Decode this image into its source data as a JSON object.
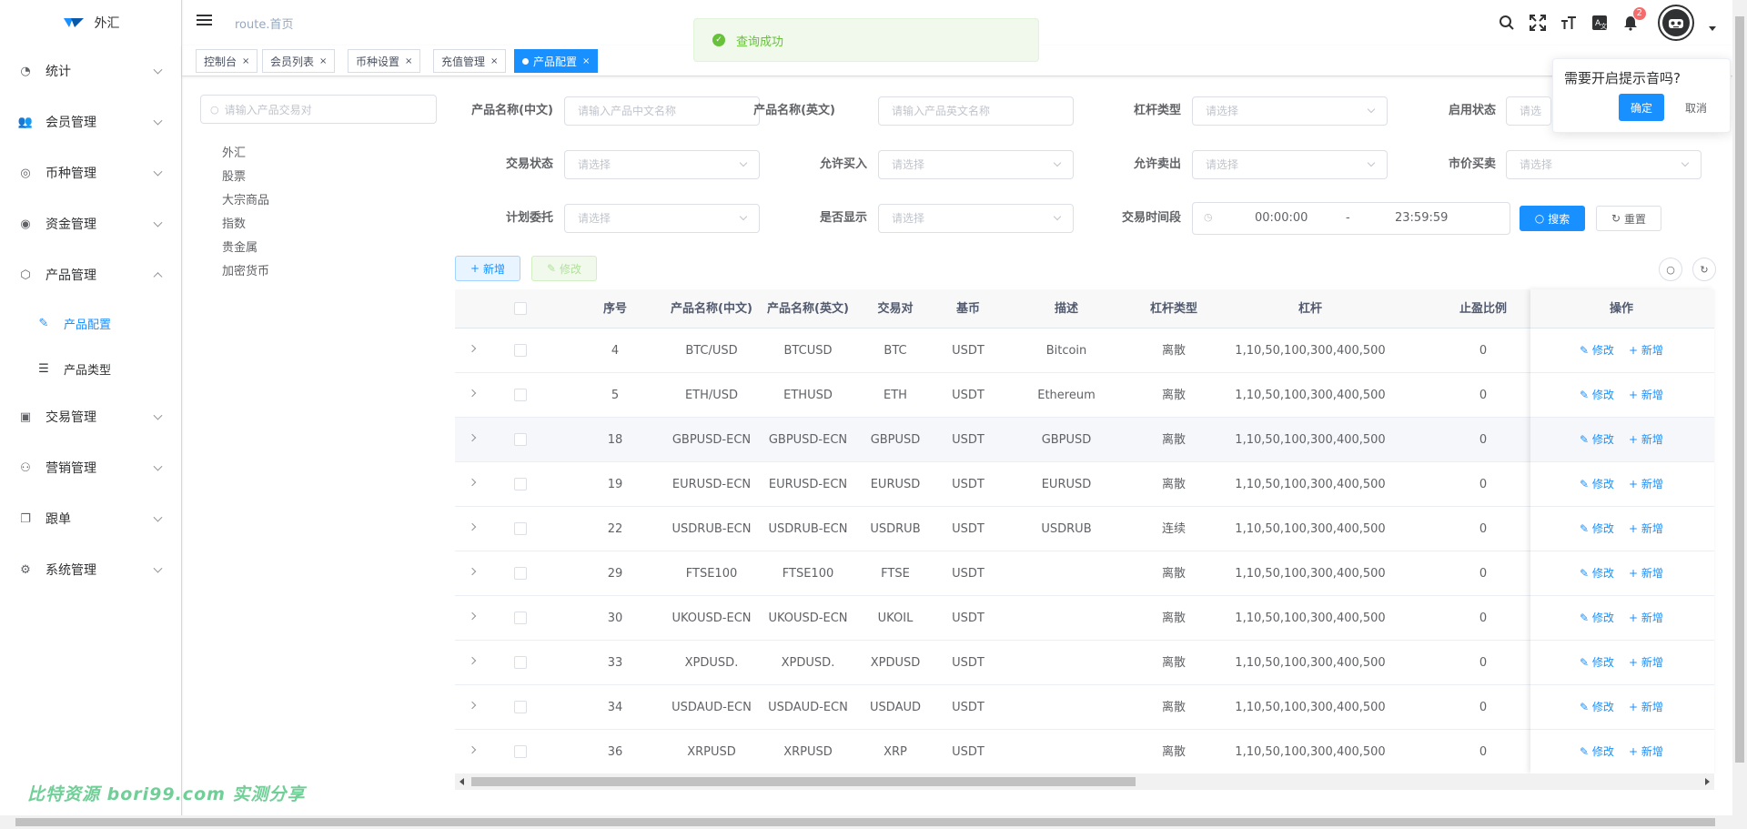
{
  "sidebar": {
    "logo_text": "外汇",
    "menu": [
      {
        "label": "统计",
        "icon": "dashboard-icon"
      },
      {
        "label": "会员管理",
        "icon": "users-icon"
      },
      {
        "label": "币种管理",
        "icon": "coin-icon"
      },
      {
        "label": "资金管理",
        "icon": "money-icon"
      },
      {
        "label": "产品管理",
        "icon": "box-icon",
        "expanded": true
      }
    ],
    "submenu": [
      {
        "label": "产品配置",
        "icon": "edit-icon",
        "active": true
      },
      {
        "label": "产品类型",
        "icon": "list-icon"
      }
    ],
    "menu_after": [
      {
        "label": "交易管理",
        "icon": "trade-icon"
      },
      {
        "label": "营销管理",
        "icon": "people-icon"
      },
      {
        "label": "跟单",
        "icon": "copy-icon"
      },
      {
        "label": "系统管理",
        "icon": "gear-icon"
      }
    ]
  },
  "header": {
    "breadcrumb": "route.首页",
    "notification_count": "2"
  },
  "tags": [
    {
      "label": "控制台"
    },
    {
      "label": "会员列表"
    },
    {
      "label": "币种设置"
    },
    {
      "label": "充值管理"
    },
    {
      "label": "产品配置",
      "active": true
    }
  ],
  "toast": {
    "message": "查询成功"
  },
  "popover": {
    "title": "需要开启提示音吗?",
    "confirm": "确定",
    "cancel": "取消"
  },
  "tree": {
    "search_placeholder": "请输入产品交易对",
    "nodes": [
      "外汇",
      "股票",
      "大宗商品",
      "指数",
      "贵金属",
      "加密货币"
    ]
  },
  "filters": {
    "product_name_cn": {
      "label": "产品名称(中文)",
      "placeholder": "请输入产品中文名称"
    },
    "product_name_en": {
      "label": "产品名称(英文)",
      "placeholder": "请输入产品英文名称"
    },
    "leverage_type": {
      "label": "杠杆类型",
      "placeholder": "请选择"
    },
    "enabled_status": {
      "label": "启用状态",
      "placeholder": "请选择"
    },
    "trade_status": {
      "label": "交易状态",
      "placeholder": "请选择"
    },
    "allow_buy": {
      "label": "允许买入",
      "placeholder": "请选择"
    },
    "allow_sell": {
      "label": "允许卖出",
      "placeholder": "请选择"
    },
    "market_buy_sell": {
      "label": "市价买卖",
      "placeholder": "请选择"
    },
    "plan_order": {
      "label": "计划委托",
      "placeholder": "请选择"
    },
    "is_display": {
      "label": "是否显示",
      "placeholder": "请选择"
    },
    "trade_time": {
      "label": "交易时间段",
      "start": "00:00:00",
      "separator": "-",
      "end": "23:59:59"
    },
    "search_label": "搜索",
    "reset_label": "重置"
  },
  "toolbar": {
    "add_label": "新增",
    "edit_label": "修改"
  },
  "table": {
    "columns": [
      "序号",
      "产品名称(中文)",
      "产品名称(英文)",
      "交易对",
      "基币",
      "描述",
      "杠杆类型",
      "杠杆",
      "止盈比例",
      "操作"
    ],
    "action_edit": "修改",
    "action_add": "新增",
    "rows": [
      {
        "id": "4",
        "name_cn": "BTC/USD",
        "name_en": "BTCUSD",
        "pair": "BTC",
        "base": "USDT",
        "desc": "Bitcoin",
        "lev_type": "离散",
        "leverage": "1,10,50,100,300,400,500",
        "tp": "0"
      },
      {
        "id": "5",
        "name_cn": "ETH/USD",
        "name_en": "ETHUSD",
        "pair": "ETH",
        "base": "USDT",
        "desc": "Ethereum",
        "lev_type": "离散",
        "leverage": "1,10,50,100,300,400,500",
        "tp": "0"
      },
      {
        "id": "18",
        "name_cn": "GBPUSD-ECN",
        "name_en": "GBPUSD-ECN",
        "pair": "GBPUSD",
        "base": "USDT",
        "desc": "GBPUSD",
        "lev_type": "离散",
        "leverage": "1,10,50,100,300,400,500",
        "tp": "0"
      },
      {
        "id": "19",
        "name_cn": "EURUSD-ECN",
        "name_en": "EURUSD-ECN",
        "pair": "EURUSD",
        "base": "USDT",
        "desc": "EURUSD",
        "lev_type": "离散",
        "leverage": "1,10,50,100,300,400,500",
        "tp": "0"
      },
      {
        "id": "22",
        "name_cn": "USDRUB-ECN",
        "name_en": "USDRUB-ECN",
        "pair": "USDRUB",
        "base": "USDT",
        "desc": "USDRUB",
        "lev_type": "连续",
        "leverage": "1,10,50,100,300,400,500",
        "tp": "0"
      },
      {
        "id": "29",
        "name_cn": "FTSE100",
        "name_en": "FTSE100",
        "pair": "FTSE",
        "base": "USDT",
        "desc": "",
        "lev_type": "离散",
        "leverage": "1,10,50,100,300,400,500",
        "tp": "0"
      },
      {
        "id": "30",
        "name_cn": "UKOUSD-ECN",
        "name_en": "UKOUSD-ECN",
        "pair": "UKOIL",
        "base": "USDT",
        "desc": "",
        "lev_type": "离散",
        "leverage": "1,10,50,100,300,400,500",
        "tp": "0"
      },
      {
        "id": "33",
        "name_cn": "XPDUSD.",
        "name_en": "XPDUSD.",
        "pair": "XPDUSD",
        "base": "USDT",
        "desc": "",
        "lev_type": "离散",
        "leverage": "1,10,50,100,300,400,500",
        "tp": "0"
      },
      {
        "id": "34",
        "name_cn": "USDAUD-ECN",
        "name_en": "USDAUD-ECN",
        "pair": "USDAUD",
        "base": "USDT",
        "desc": "",
        "lev_type": "离散",
        "leverage": "1,10,50,100,300,400,500",
        "tp": "0"
      },
      {
        "id": "36",
        "name_cn": "XRPUSD",
        "name_en": "XRPUSD",
        "pair": "XRP",
        "base": "USDT",
        "desc": "",
        "lev_type": "离散",
        "leverage": "1,10,50,100,300,400,500",
        "tp": "0"
      }
    ]
  },
  "watermark": "比特资源 bori99.com 实测分享",
  "colors": {
    "primary": "#1890ff",
    "success": "#67c23a",
    "danger": "#f56c6c"
  }
}
